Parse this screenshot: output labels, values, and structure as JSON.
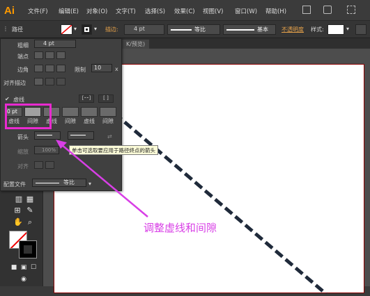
{
  "app": {
    "logo": "Ai"
  },
  "menu": [
    "文件(F)",
    "编辑(E)",
    "对象(O)",
    "文字(T)",
    "选择(S)",
    "效果(C)",
    "视图(V)",
    "窗口(W)",
    "帮助(H)"
  ],
  "control_bar": {
    "object_type": "路径",
    "stroke_label": "描边:",
    "stroke_weight": "4 pt",
    "profile_label": "等比",
    "brush_label": "基本",
    "opacity_label": "不透明度",
    "style_label": "样式:"
  },
  "document_tab": {
    "label": "K/预览)"
  },
  "stroke_panel": {
    "weight_label": "粗细",
    "weight_value": "4 pt",
    "cap_label": "端点",
    "corner_label": "边角",
    "limit_label": "限制",
    "limit_value": "10",
    "limit_unit": "x",
    "align_label": "对齐描边",
    "dashed_label": "虚线",
    "dashed_checked": true,
    "dash_fields": [
      {
        "value": "0 pt",
        "label": "虚线"
      },
      {
        "value": "",
        "label": "间隙"
      },
      {
        "value": "",
        "label": "虚线"
      },
      {
        "value": "",
        "label": "间隙"
      },
      {
        "value": "",
        "label": "虚线"
      },
      {
        "value": "",
        "label": "间隙"
      }
    ],
    "arrowhead_label": "箭头",
    "scale_label": "缩放",
    "scale_value": "100%",
    "align_arrow_label": "对齐",
    "profile_label": "配置文件",
    "profile_value": "等比"
  },
  "tooltip": {
    "text": "单击可选取要应用于路径终点的箭头"
  },
  "annotation": {
    "text": "调整虚线和间隙"
  },
  "colors": {
    "annotation": "#d83fe6",
    "highlight": "#e92ad0",
    "dash_line": "#1f2a3a",
    "artboard_border": "#8a0000"
  }
}
